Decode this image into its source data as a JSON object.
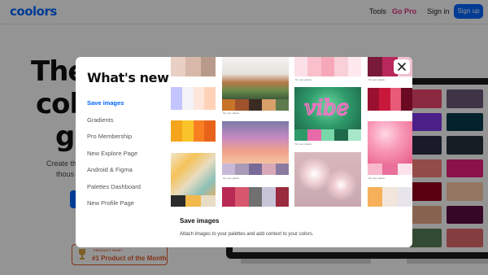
{
  "header": {
    "logo": "coolors",
    "nav_tools": "Tools",
    "nav_gopro": "Go Pro",
    "signin": "Sign in",
    "signup": "Sign up"
  },
  "hero": {
    "line1": "The",
    "line2": "col",
    "line3": "ge",
    "sub1": "Create th",
    "sub2": "thous"
  },
  "product_hunt": {
    "small": "PRODUCT HUNT",
    "big": "#1 Product of the Month"
  },
  "modal": {
    "title": "What's new",
    "menu": [
      {
        "label": "Save images",
        "active": true
      },
      {
        "label": "Gradients",
        "active": false
      },
      {
        "label": "Pro Membership",
        "active": false
      },
      {
        "label": "New Explore Page",
        "active": false
      },
      {
        "label": "Android & Figma",
        "active": false
      },
      {
        "label": "Palettes Dashboard",
        "active": false
      },
      {
        "label": "New Profile Page",
        "active": false
      }
    ],
    "caption": "My new palette",
    "footer_title": "Save images",
    "footer_text": "Attach images to your palettes and add context to your colors.",
    "close_icon": "close-icon"
  },
  "colors": {
    "accent": "#0066ff",
    "gopro": "#e0337a",
    "producthunt": "#e05a2b"
  }
}
